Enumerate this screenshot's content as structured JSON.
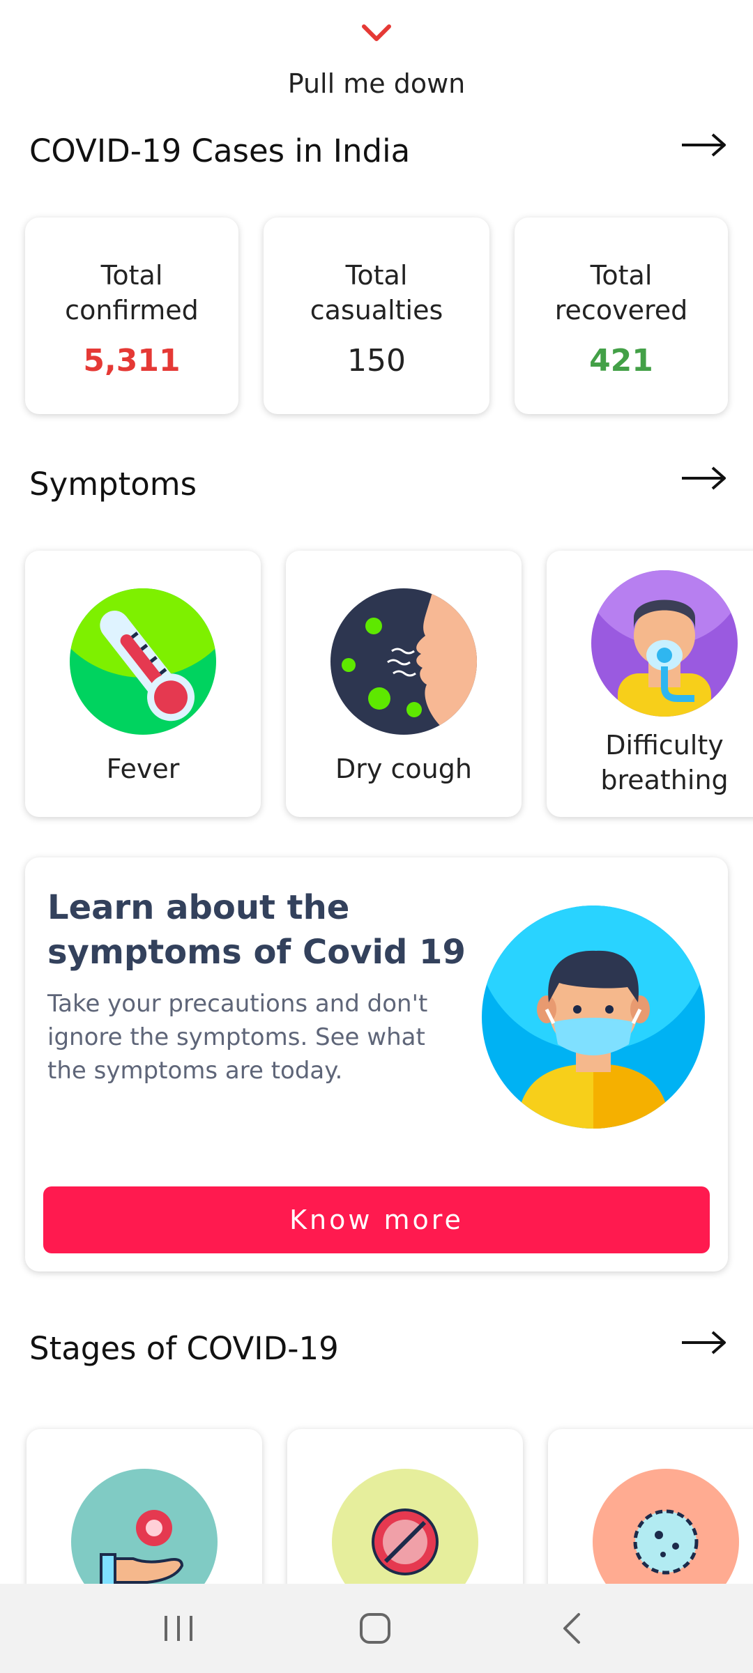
{
  "pull": {
    "label": "Pull me down",
    "icon": "chevron-down-icon",
    "color": "#e53935"
  },
  "cases": {
    "title": "COVID-19 Cases in India",
    "stats": [
      {
        "label_1": "Total",
        "label_2": "confirmed",
        "value": "5,311",
        "color": "#e53935"
      },
      {
        "label_1": "Total",
        "label_2": "casualties",
        "value": "150",
        "color": "#222222"
      },
      {
        "label_1": "Total",
        "label_2": "recovered",
        "value": "421",
        "color": "#43a047"
      }
    ]
  },
  "symptoms": {
    "title": "Symptoms",
    "items": [
      {
        "label_1": "Fever",
        "label_2": "",
        "icon": "thermometer-icon"
      },
      {
        "label_1": "Dry cough",
        "label_2": "",
        "icon": "cough-icon"
      },
      {
        "label_1": "Difficulty",
        "label_2": "breathing",
        "icon": "oxygen-mask-icon"
      }
    ]
  },
  "learn": {
    "heading": "Learn about the symptoms of Covid 19",
    "body": "Take your precautions and don't ignore the symptoms. See what the symptoms are today.",
    "button": "Know more",
    "button_color": "#ff1a4f",
    "icon": "masked-person-icon"
  },
  "stages": {
    "title": "Stages of COVID-19",
    "items": [
      {
        "icon": "virus-hand-icon"
      },
      {
        "icon": "no-virus-icon"
      },
      {
        "icon": "virus-cell-icon"
      }
    ]
  },
  "navbar": {
    "recent": "recent-apps-icon",
    "home": "home-icon",
    "back": "back-icon"
  }
}
